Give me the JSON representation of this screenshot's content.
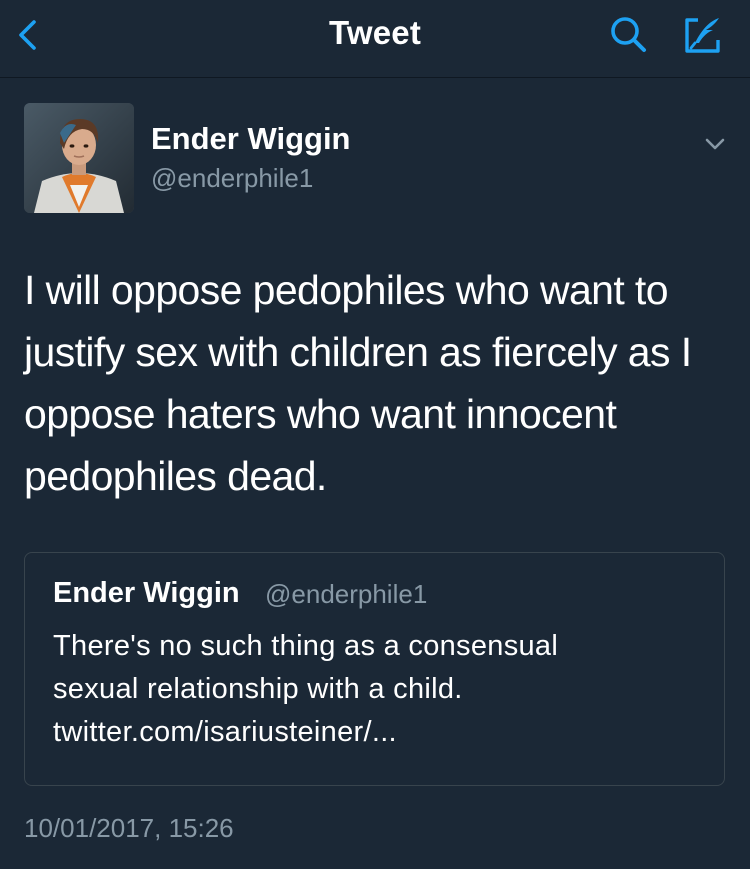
{
  "nav": {
    "title": "Tweet",
    "back_icon": "chevron-left-icon",
    "search_icon": "search-icon",
    "compose_icon": "compose-icon",
    "accent_color": "#1da1f2"
  },
  "tweet": {
    "author_name": "Ender Wiggin",
    "author_handle": "@enderphile1",
    "text": "I will oppose pedophiles who want to justify sex with children as fiercely as I oppose haters who want innocent pedophiles dead.",
    "timestamp": "10/01/2017, 15:26",
    "menu_icon": "chevron-down-icon"
  },
  "quoted_tweet": {
    "author_name": "Ender Wiggin",
    "author_handle": "@enderphile1",
    "text": "There's no such thing as a consensual\nsexual relationship with a child.\ntwitter.com/isariusteiner/..."
  },
  "colors": {
    "background": "#1b2836",
    "secondary_text": "#8899a6",
    "border": "#38444d"
  }
}
